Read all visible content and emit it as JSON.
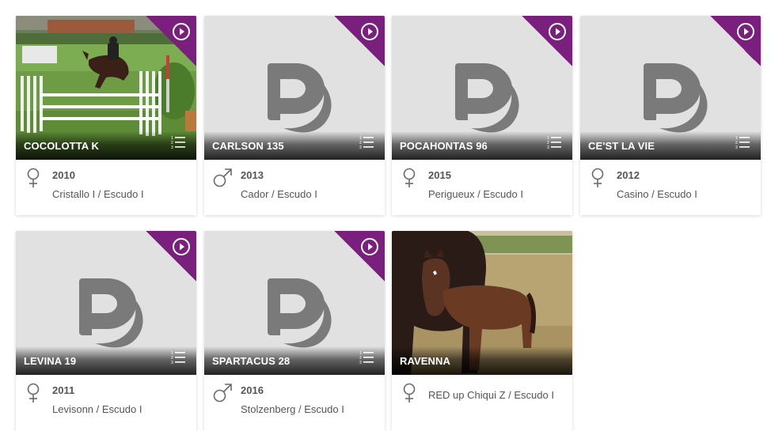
{
  "colors": {
    "accent": "#7a1f7e",
    "placeholder_bg": "#e1e1e1",
    "logo_gray": "#7a7a7a",
    "text": "#555555"
  },
  "cards": [
    {
      "name": "COCOLOTTA K",
      "gender": "female",
      "gender_icon": "female-symbol-icon",
      "year": "2010",
      "parents": "Cristallo I / Escudo I",
      "image": "photo-show-jumping",
      "video": true
    },
    {
      "name": "CARLSON 135",
      "gender": "male",
      "gender_icon": "male-symbol-icon",
      "year": "2013",
      "parents": "Cador / Escudo I",
      "image": "placeholder-logo",
      "video": true
    },
    {
      "name": "POCAHONTAS 96",
      "gender": "female",
      "gender_icon": "female-symbol-icon",
      "year": "2015",
      "parents": "Perigueux / Escudo I",
      "image": "placeholder-logo",
      "video": true
    },
    {
      "name": "CE'ST LA VIE",
      "gender": "female",
      "gender_icon": "female-symbol-icon",
      "year": "2012",
      "parents": "Casino / Escudo I",
      "image": "placeholder-logo",
      "video": true
    },
    {
      "name": "LEVINA 19",
      "gender": "female",
      "gender_icon": "female-symbol-icon",
      "year": "2011",
      "parents": "Levisonn / Escudo I",
      "image": "placeholder-logo",
      "video": true
    },
    {
      "name": "SPARTACUS 28",
      "gender": "male",
      "gender_icon": "male-symbol-icon",
      "year": "2016",
      "parents": "Stolzenberg / Escudo I",
      "image": "placeholder-logo",
      "video": true
    },
    {
      "name": "RAVENNA",
      "gender": "female",
      "gender_icon": "female-symbol-icon",
      "year": "",
      "parents": "RED up Chiqui Z / Escudo I",
      "image": "photo-foal",
      "video": false
    }
  ]
}
